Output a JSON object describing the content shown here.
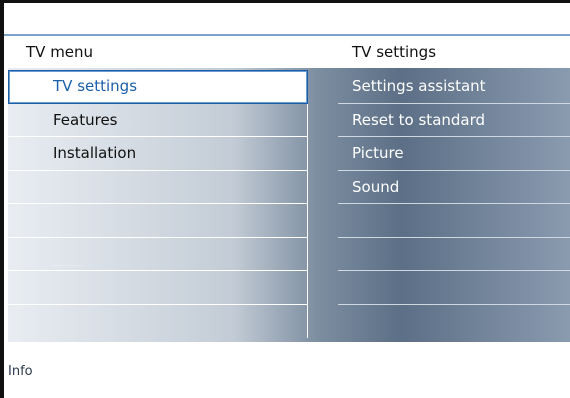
{
  "menu": {
    "left_title": "TV menu",
    "right_title": "TV settings",
    "left_items": [
      {
        "label": "TV settings"
      },
      {
        "label": "Features"
      },
      {
        "label": "Installation"
      },
      {
        "label": ""
      },
      {
        "label": ""
      },
      {
        "label": ""
      },
      {
        "label": ""
      },
      {
        "label": ""
      }
    ],
    "right_items": [
      {
        "label": "Settings assistant"
      },
      {
        "label": "Reset to standard"
      },
      {
        "label": "Picture"
      },
      {
        "label": "Sound"
      },
      {
        "label": ""
      },
      {
        "label": ""
      },
      {
        "label": ""
      },
      {
        "label": ""
      }
    ]
  },
  "footer": {
    "info": "Info"
  },
  "colors": {
    "accent": "#1b5fa8",
    "divider": "#7aa3cc"
  }
}
